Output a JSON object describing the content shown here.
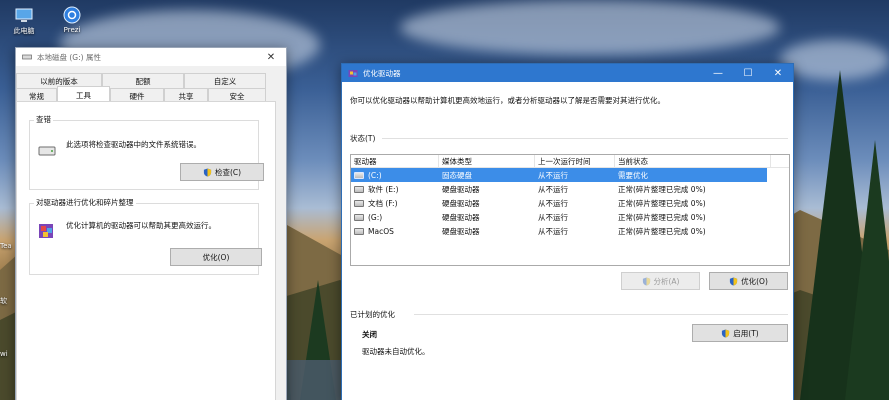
{
  "desktop": {
    "icons": [
      {
        "label": "此电脑",
        "icon": "computer-icon"
      },
      {
        "label": "Prezi",
        "icon": "prezi-icon"
      }
    ],
    "edge_labels": [
      "Tea",
      "软",
      "wi"
    ]
  },
  "properties_window": {
    "title": "本地磁盘 (G:) 属性",
    "close": "✕",
    "tabs_row1": [
      "以前的版本",
      "配额",
      "自定义"
    ],
    "tabs_row2": [
      "常规",
      "工具",
      "硬件",
      "共享",
      "安全"
    ],
    "active_tab": "工具",
    "check_group": {
      "title": "查错",
      "text": "此选项将检查驱动器中的文件系统错误。",
      "button": "检查(C)"
    },
    "optimize_group": {
      "title": "对驱动器进行优化和碎片整理",
      "text": "优化计算机的驱动器可以帮助其更高效运行。",
      "button": "优化(O)"
    }
  },
  "optimize_window": {
    "title": "优化驱动器",
    "controls": {
      "minimize": "—",
      "maximize": "☐",
      "close": "✕"
    },
    "description": "你可以优化驱动器以帮助计算机更高效地运行，或者分析驱动器以了解是否需要对其进行优化。",
    "status_label": "状态(T)",
    "table": {
      "headers": [
        "驱动器",
        "媒体类型",
        "上一次运行时间",
        "当前状态"
      ],
      "rows": [
        {
          "drive": "(C:)",
          "media": "固态硬盘",
          "last_run": "从不运行",
          "status": "需要优化",
          "selected": true
        },
        {
          "drive": "软件 (E:)",
          "media": "硬盘驱动器",
          "last_run": "从不运行",
          "status": "正常(碎片整理已完成 0%)",
          "selected": false
        },
        {
          "drive": "文档 (F:)",
          "media": "硬盘驱动器",
          "last_run": "从不运行",
          "status": "正常(碎片整理已完成 0%)",
          "selected": false
        },
        {
          "drive": "(G:)",
          "media": "硬盘驱动器",
          "last_run": "从不运行",
          "status": "正常(碎片整理已完成 0%)",
          "selected": false
        },
        {
          "drive": "MacOS",
          "media": "硬盘驱动器",
          "last_run": "从不运行",
          "status": "正常(碎片整理已完成 0%)",
          "selected": false
        }
      ]
    },
    "analyze_button": "分析(A)",
    "optimize_button": "优化(O)",
    "scheduled_label": "已计划的优化",
    "scheduled_state": "关闭",
    "scheduled_text": "驱动器未自动优化。",
    "enable_button": "启用(T)"
  },
  "colors": {
    "accent": "#2e77cf",
    "selection": "#3c8de8",
    "shield_blue": "#2a63c4",
    "shield_yellow": "#f2c21b"
  }
}
